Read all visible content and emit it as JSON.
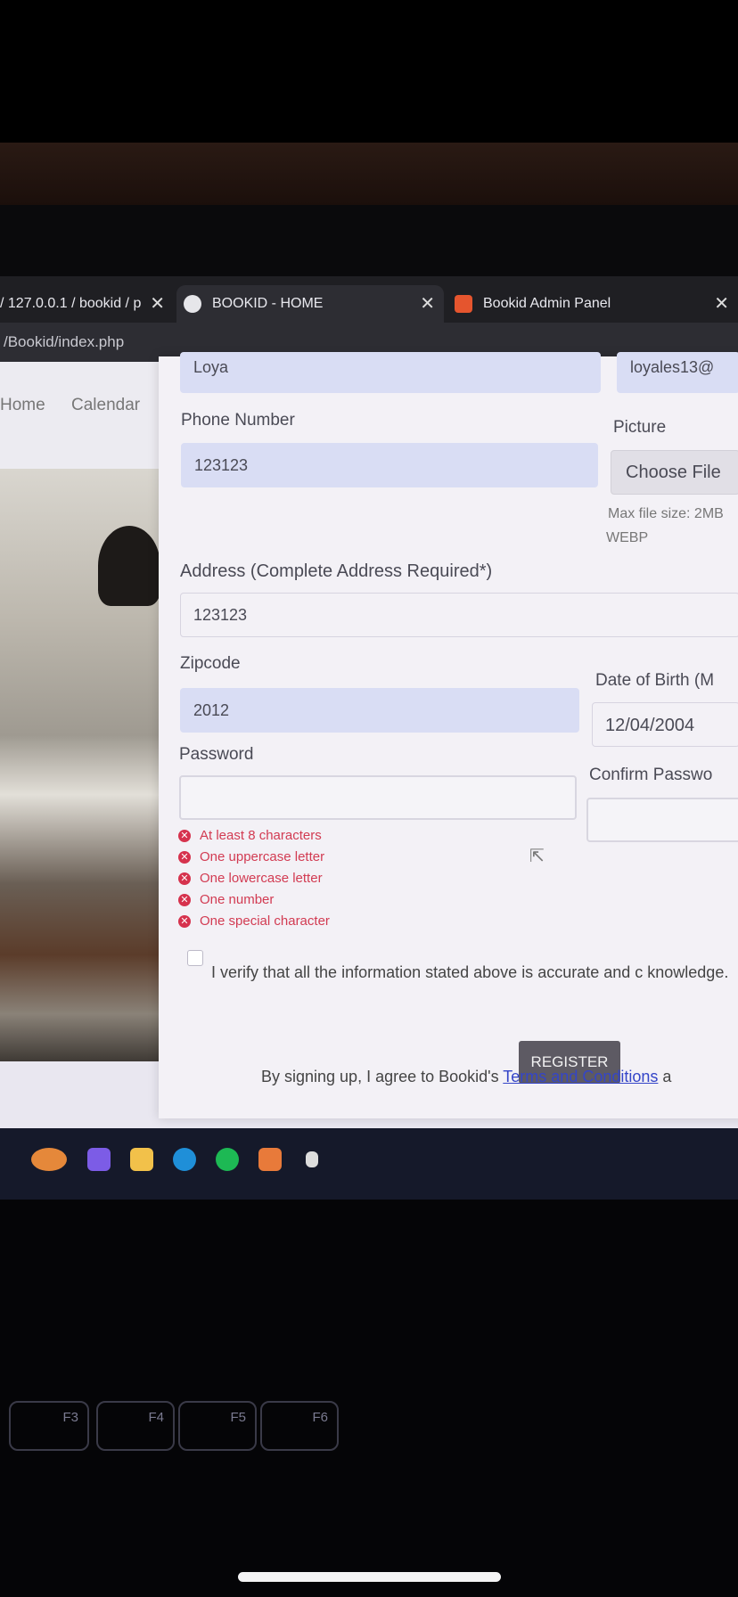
{
  "tabs": [
    {
      "label": "/ 127.0.0.1 / bookid / p",
      "close": "✕"
    },
    {
      "label": "BOOKID - HOME",
      "close": "✕"
    },
    {
      "label": "Bookid Admin Panel",
      "close": "✕"
    }
  ],
  "address": "/Bookid/index.php",
  "nav": {
    "home": "Home",
    "calendar": "Calendar"
  },
  "form": {
    "top_left_value": "Loya",
    "top_right_value": "loyales13@",
    "phone": {
      "label": "Phone Number",
      "value": "123123"
    },
    "picture": {
      "label": "Picture",
      "button": "Choose File",
      "hint_line1": "Max file size: 2MB",
      "hint_line2": "WEBP"
    },
    "address": {
      "label": "Address (Complete Address Required*)",
      "value": "123123"
    },
    "zipcode": {
      "label": "Zipcode",
      "value": "2012"
    },
    "dob": {
      "label": "Date of Birth (M",
      "value": "12/04/2004"
    },
    "password": {
      "label": "Password",
      "value": ""
    },
    "confirm_password": {
      "label": "Confirm Passwo",
      "value": ""
    },
    "rules": [
      "At least 8 characters",
      "One uppercase letter",
      "One lowercase letter",
      "One number",
      "One special character"
    ],
    "verify_text": "I verify that all the information stated above is accurate and c knowledge.",
    "register_button": "REGISTER",
    "terms_prefix": "By signing up, I agree to Bookid's",
    "terms_link": "Terms and Conditions",
    "terms_suffix": "a"
  },
  "keys": [
    "F3",
    "F4",
    "F5",
    "F6"
  ],
  "colors": {
    "accent_link": "#3445c8",
    "error": "#d23b52",
    "filled_field": "#d9ddf4"
  }
}
